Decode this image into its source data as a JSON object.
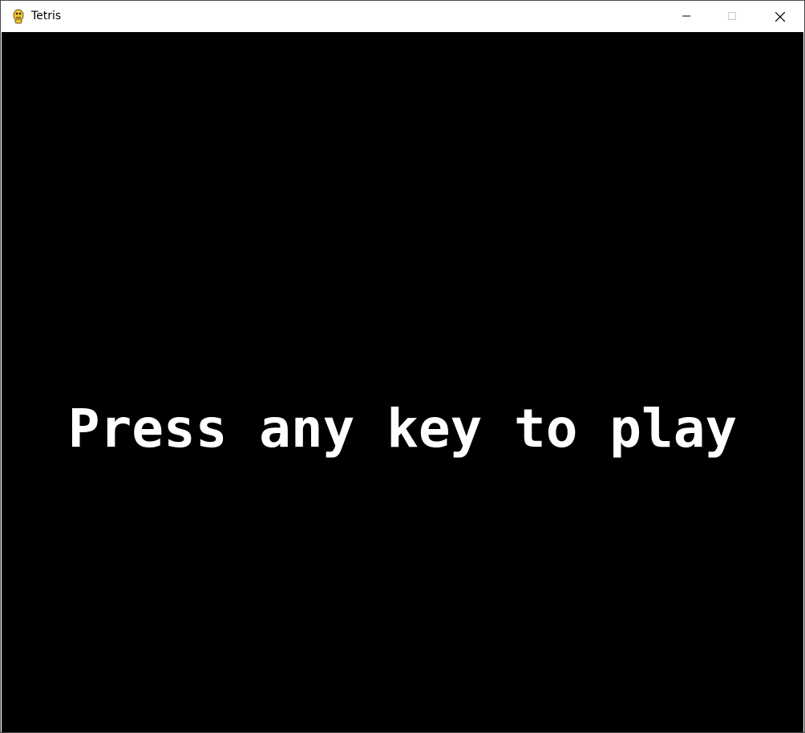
{
  "window": {
    "title": "Tetris",
    "icon": "pygame-snake-icon",
    "controls": {
      "minimize_icon": "minimize-icon",
      "maximize_icon": "maximize-icon",
      "close_icon": "close-icon"
    }
  },
  "game": {
    "prompt": "Press any key to play",
    "background_color": "#000000",
    "text_color": "#ffffff"
  }
}
